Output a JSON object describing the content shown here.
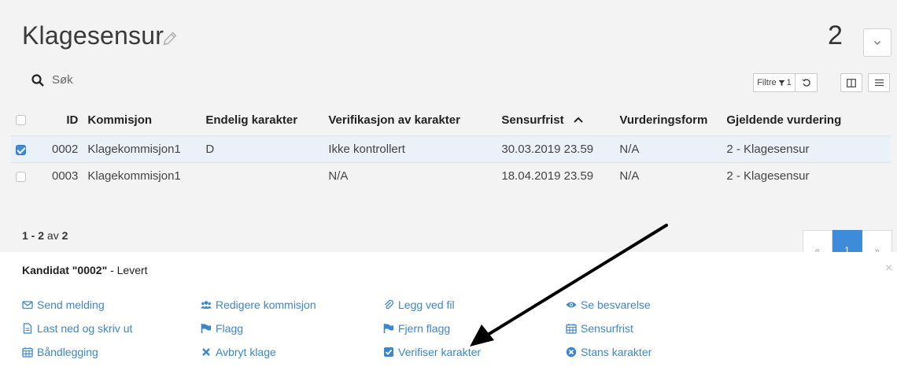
{
  "header": {
    "title": "Klagesensur",
    "count": "2",
    "dropdown_glyph": "⌄"
  },
  "toolbar": {
    "search_placeholder": "Søk",
    "filter_label": "Filtre",
    "filter_count": "1",
    "icons": [
      "filter-icon",
      "reset-icon",
      "columns-icon",
      "menu-icon"
    ]
  },
  "table": {
    "columns": [
      "ID",
      "Kommisjon",
      "Endelig karakter",
      "Verifikasjon av karakter",
      "Sensurfrist",
      "Vurderingsform",
      "Gjeldende vurdering"
    ],
    "sort_column": "Sensurfrist",
    "rows": [
      {
        "selected": true,
        "id": "0002",
        "kommisjon": "Klagekommisjon1",
        "endelig": "D",
        "verifikasjon": "Ikke kontrollert",
        "sensurfrist": "30.03.2019 23.59",
        "vurderingsform": "N/A",
        "gjeldende": "2 - Klagesensur"
      },
      {
        "selected": false,
        "id": "0003",
        "kommisjon": "Klagekommisjon1",
        "endelig": "",
        "verifikasjon": "N/A",
        "sensurfrist": "18.04.2019 23.59",
        "vurderingsform": "N/A",
        "gjeldende": "2 - Klagesensur"
      }
    ]
  },
  "pagination": {
    "range": "1 - 2",
    "of_word": "av",
    "total": "2",
    "prev": "«",
    "current": "1",
    "next": "»"
  },
  "panel": {
    "title_prefix": "Kandidat",
    "candidate": "\"0002\"",
    "status": "- Levert",
    "close": "×",
    "actions": [
      {
        "label": "Send melding",
        "icon": "envelope-icon"
      },
      {
        "label": "Redigere kommisjon",
        "icon": "users-icon"
      },
      {
        "label": "Legg ved fil",
        "icon": "paperclip-icon"
      },
      {
        "label": "Se besvarelse",
        "icon": "eye-icon"
      },
      {
        "label": "Last ned og skriv ut",
        "icon": "file-icon"
      },
      {
        "label": "Flagg",
        "icon": "flag-icon"
      },
      {
        "label": "Fjern flagg",
        "icon": "flag-icon"
      },
      {
        "label": "Sensurfrist",
        "icon": "calendar-icon"
      },
      {
        "label": "Båndlegging",
        "icon": "calendar-icon"
      },
      {
        "label": "Avbryt klage",
        "icon": "times-icon"
      },
      {
        "label": "Verifiser karakter",
        "icon": "check-square-icon"
      },
      {
        "label": "Stans karakter",
        "icon": "times-circle-icon"
      }
    ]
  },
  "colors": {
    "accent": "#3d86cf",
    "checkbox_on": "#3d8bd9",
    "background": "#f3f3f3"
  }
}
